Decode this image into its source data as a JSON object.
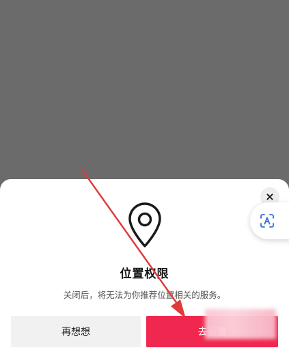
{
  "dialog": {
    "close_label": "×",
    "title": "位置权限",
    "description": "关闭后，将无法为你推荐位置相关的服务。",
    "cancel_label": "再想想",
    "confirm_label": "去设置"
  },
  "icons": {
    "location": "location-pin-icon",
    "close": "close-icon",
    "translate": "text-recognition-icon",
    "annotation": "red-arrow-annotation"
  },
  "colors": {
    "overlay": "#6b6b6b",
    "primary": "#f0274f",
    "secondary_button": "#f1f1f1",
    "arrow": "#e03a3a"
  }
}
